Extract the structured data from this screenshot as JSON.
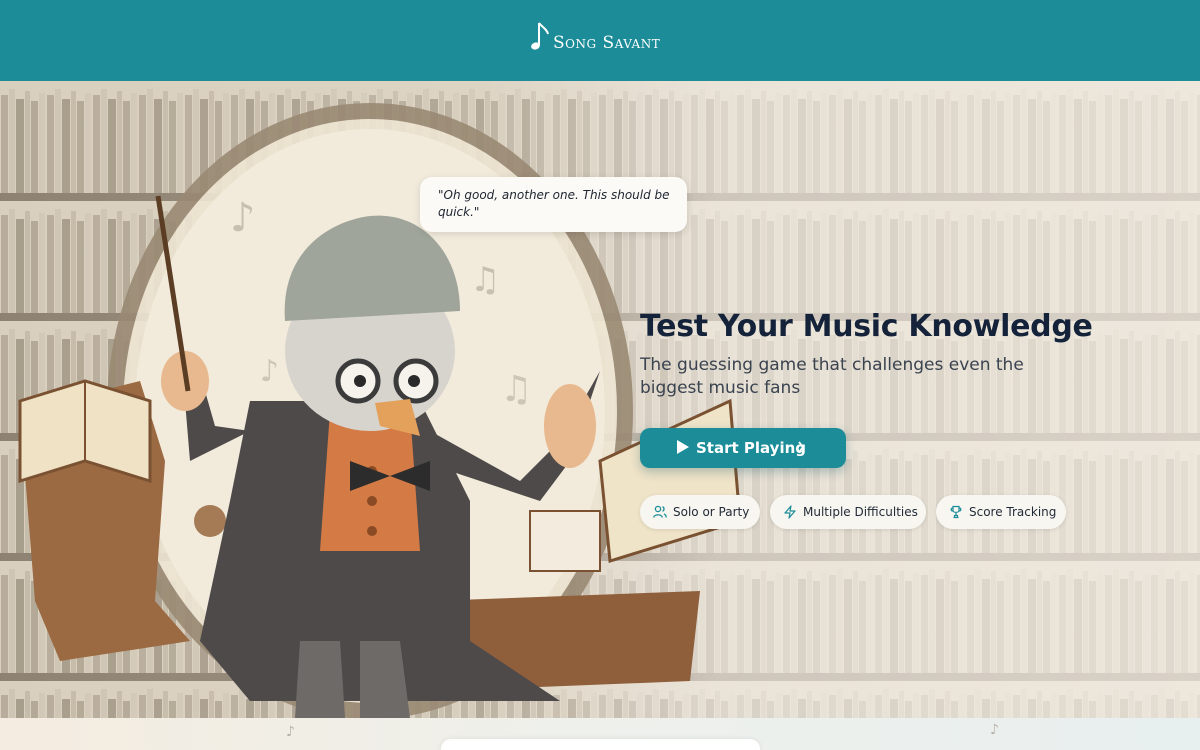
{
  "header": {
    "app_title": "Song Savant",
    "logo_icon": "music-note-icon",
    "bg_color": "#1b8c98"
  },
  "hero": {
    "speech_bubble": "\"Oh good, another one. This should be quick.\"",
    "title": "Test Your Music Knowledge",
    "subtitle": "The guessing game that challenges even the biggest music fans",
    "cta_label": "Start Playing",
    "features": [
      {
        "label": "Solo or Party",
        "icon": "users-icon"
      },
      {
        "label": "Multiple Difficulties",
        "icon": "lightning-icon"
      },
      {
        "label": "Score Tracking",
        "icon": "trophy-icon"
      }
    ]
  },
  "colors": {
    "accent": "#1b8c98",
    "title": "#14233a",
    "chip_bg": "#f8f6f1"
  }
}
